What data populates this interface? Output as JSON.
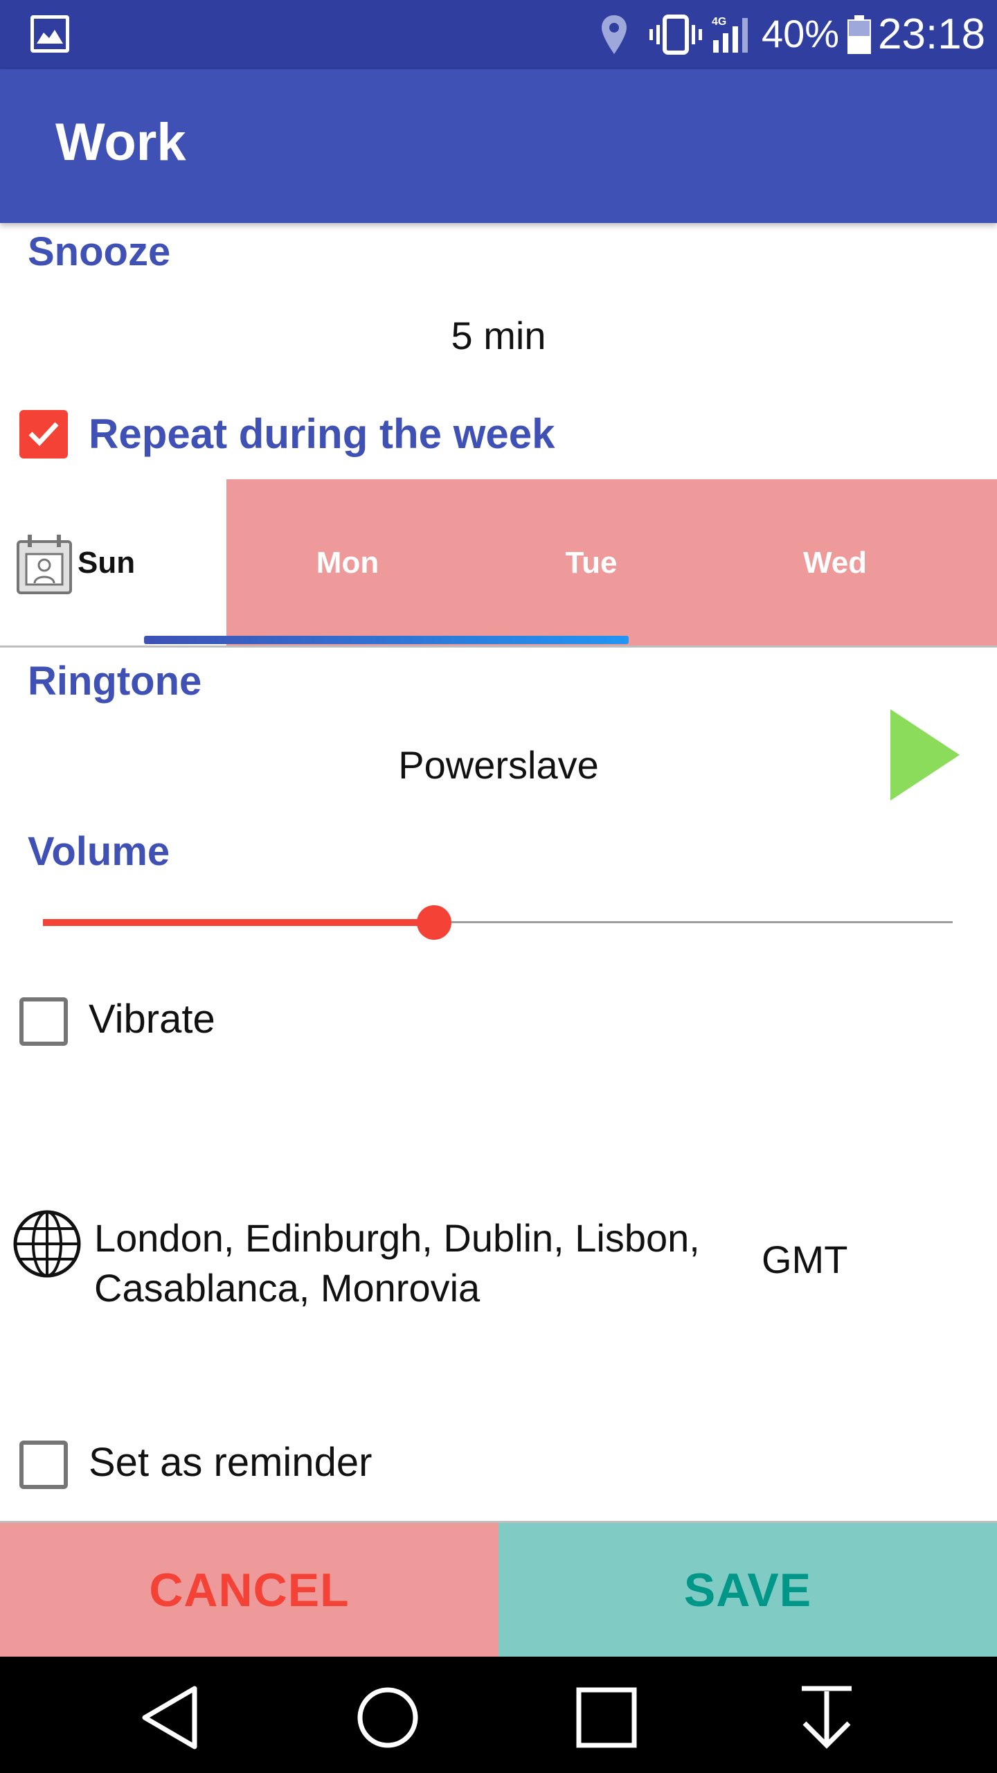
{
  "status_bar": {
    "battery_percent": "40%",
    "time": "23:18",
    "icons": [
      "gallery-icon",
      "location-icon",
      "vibrate-icon",
      "signal-4g-icon",
      "battery-icon"
    ]
  },
  "app_bar": {
    "title": "Work"
  },
  "snooze": {
    "label": "Snooze",
    "value": "5 min"
  },
  "repeat": {
    "label": "Repeat during the week",
    "checked": true
  },
  "days": {
    "tabs": [
      {
        "label": "Sun",
        "selected": false
      },
      {
        "label": "Mon",
        "selected": true
      },
      {
        "label": "Tue",
        "selected": true
      },
      {
        "label": "Wed",
        "selected": true
      }
    ],
    "highlight_color": "#ef9a9a"
  },
  "ringtone": {
    "label": "Ringtone",
    "value": "Powerslave",
    "play_icon": "play-icon"
  },
  "volume": {
    "label": "Volume",
    "level": 0.43,
    "accent_color": "#f44336"
  },
  "vibrate": {
    "label": "Vibrate",
    "checked": false
  },
  "timezone": {
    "name": "London, Edinburgh, Dublin, Lisbon, Casablanca, Monrovia",
    "code": "GMT",
    "icon": "globe-icon"
  },
  "reminder": {
    "label": "Set as reminder",
    "checked": false
  },
  "actions": {
    "cancel_label": "CANCEL",
    "save_label": "SAVE",
    "cancel_color": "#f44336",
    "save_color": "#009688"
  },
  "nav_bar": {
    "icons": [
      "back-icon",
      "home-icon",
      "recents-icon",
      "download-icon"
    ]
  },
  "colors": {
    "primary": "#3f51b5",
    "primary_dark": "#303f9f"
  }
}
